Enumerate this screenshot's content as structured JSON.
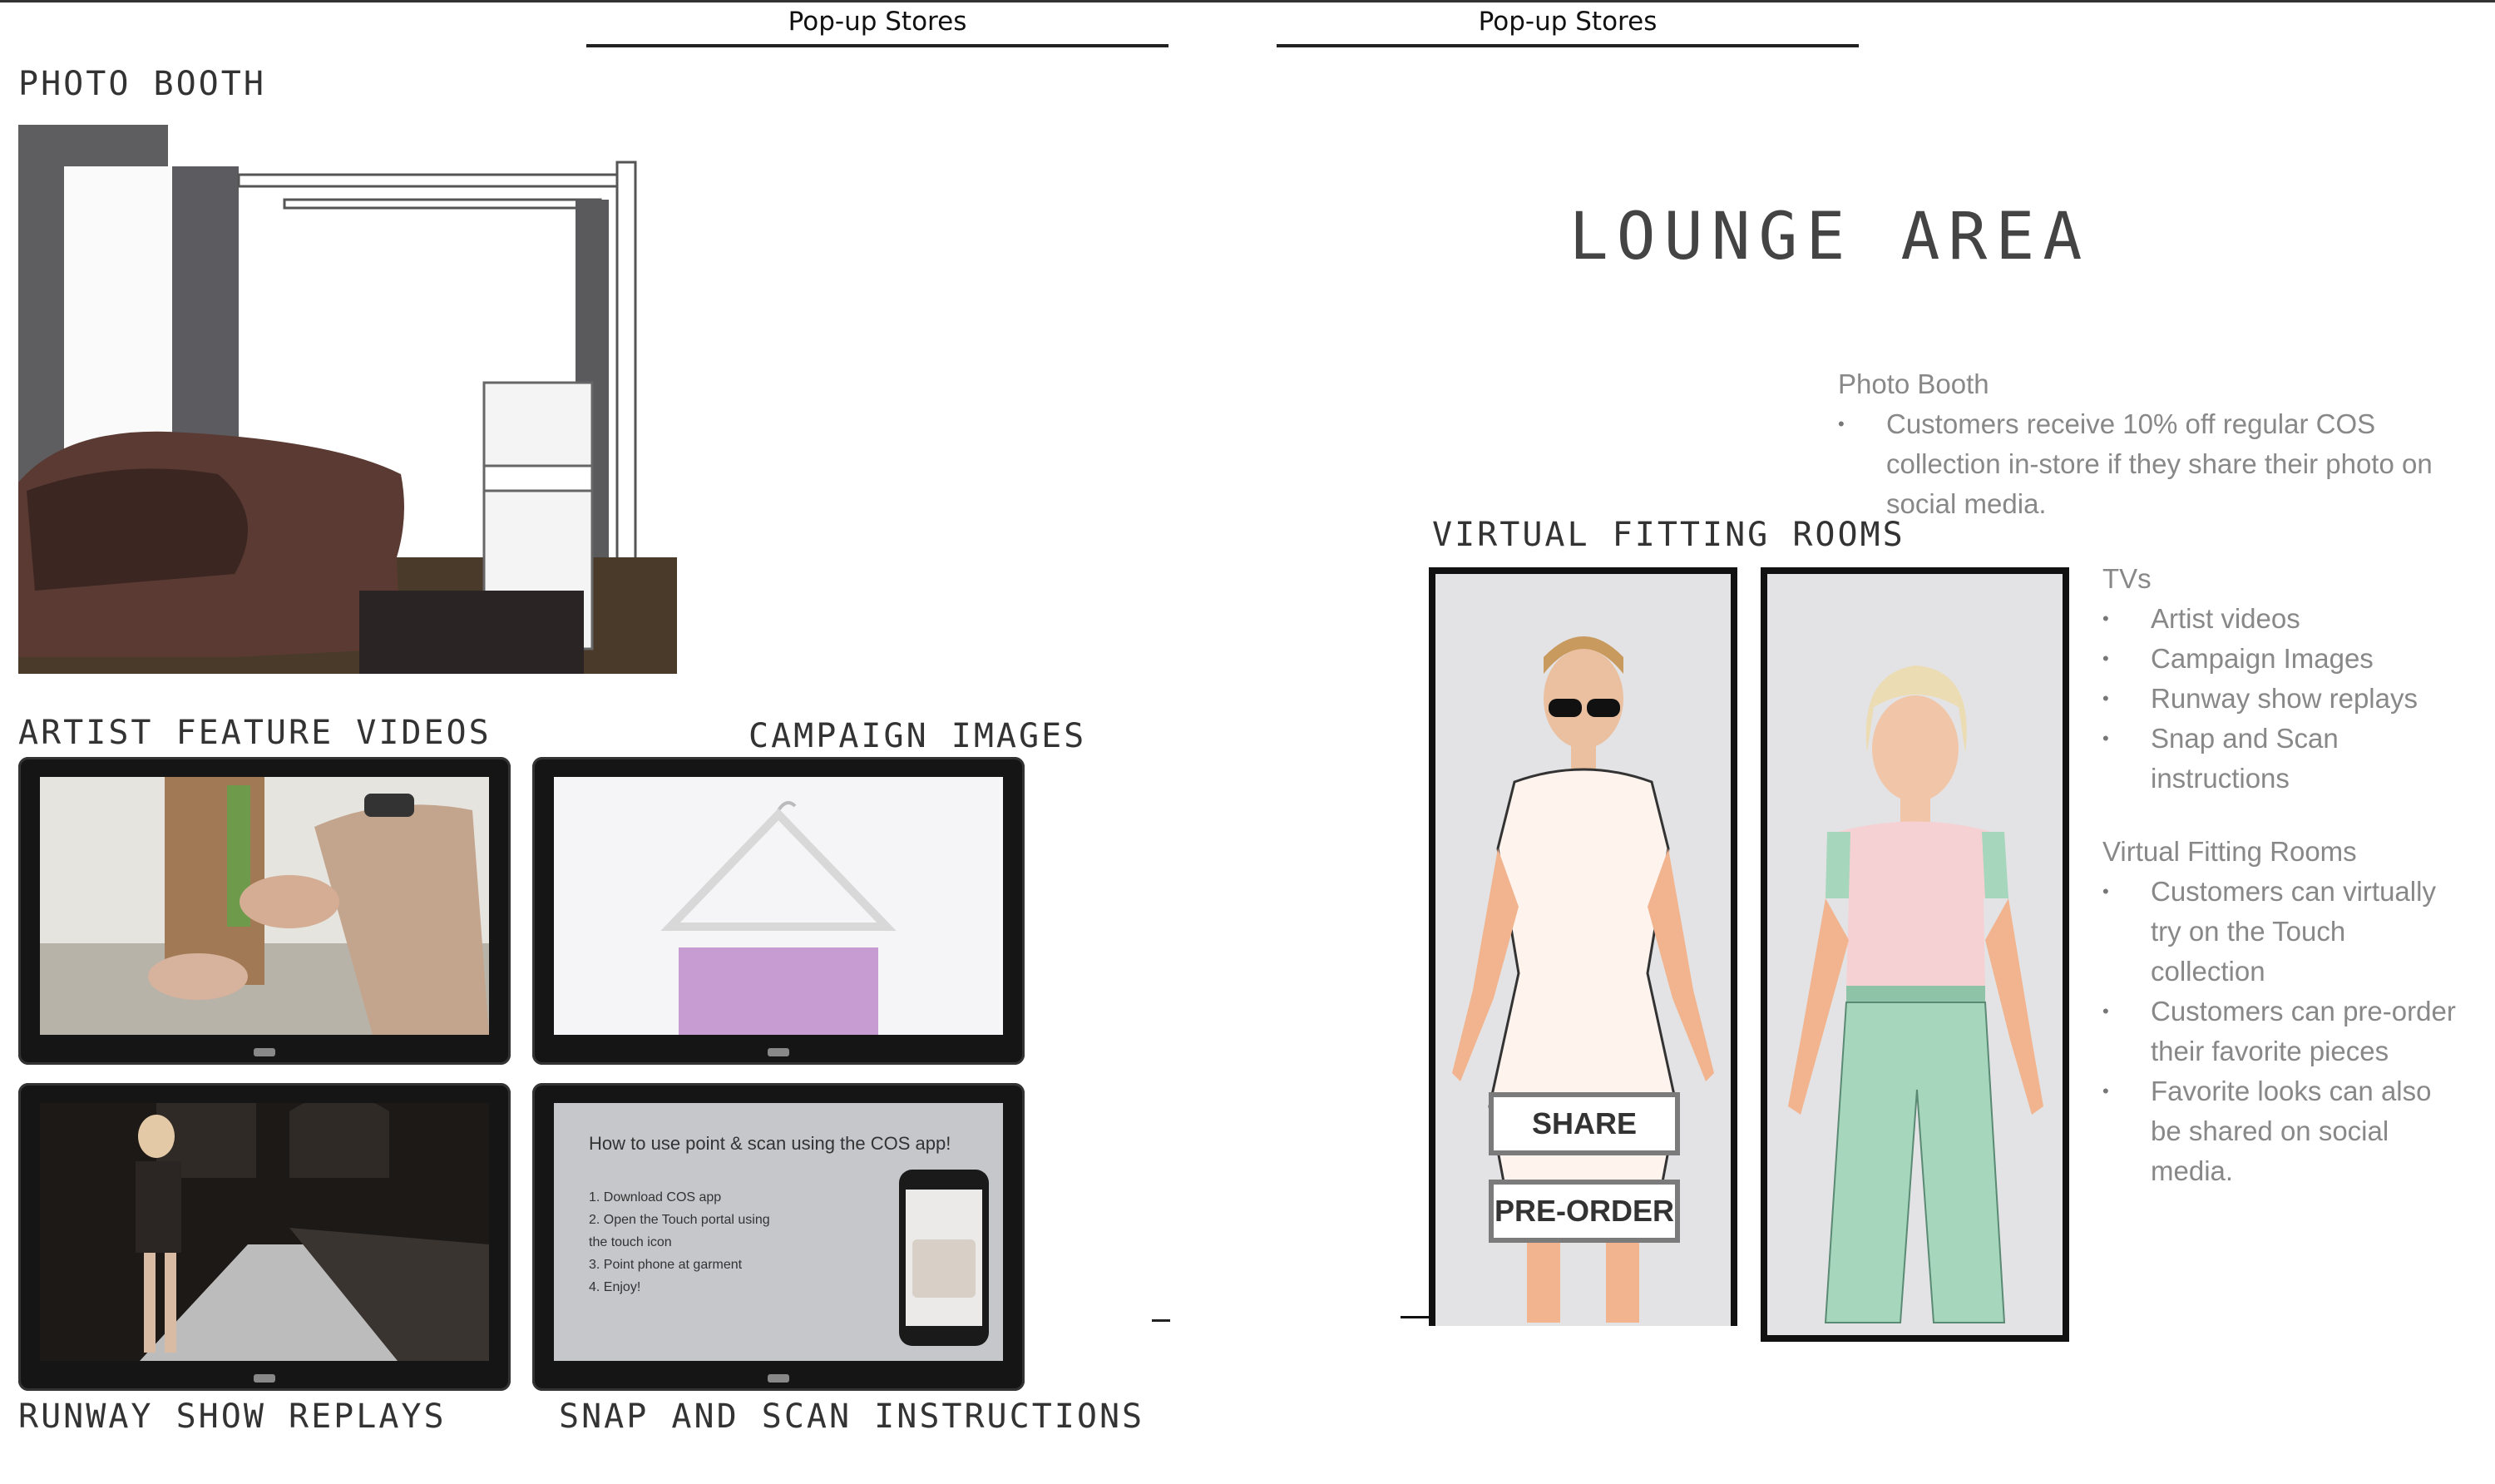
{
  "pages": {
    "left_tab": "Pop-up Stores",
    "right_tab": "Pop-up Stores"
  },
  "left": {
    "photo_booth_caption": "PHOTO BOOTH",
    "tv_captions": {
      "artist": "ARTIST FEATURE VIDEOS",
      "campaign": "CAMPAIGN IMAGES",
      "runway": "RUNWAY SHOW REPLAYS",
      "snap": "SNAP AND SCAN INSTRUCTIONS"
    },
    "snap_screen": {
      "title": "How to use point & scan using the COS app!",
      "steps": [
        "1. Download COS app",
        "2. Open the Touch portal using",
        "the touch icon",
        "3. Point phone at garment",
        "4. Enjoy!"
      ]
    }
  },
  "right": {
    "title": "LOUNGE AREA",
    "virtual_caption": "VIRTUAL FITTING ROOMS",
    "buttons": {
      "share": "SHARE",
      "preorder": "PRE-ORDER"
    },
    "photo_booth": {
      "heading": "Photo Booth",
      "bullets": [
        "Customers receive 10% off regular COS collection in-store if they share their photo on social media."
      ]
    },
    "tvs": {
      "heading": "TVs",
      "bullets": [
        "Artist videos",
        "Campaign Images",
        "Runway show replays",
        "Snap and Scan instructions"
      ]
    },
    "virtual_fitting": {
      "heading": "Virtual Fitting Rooms",
      "bullets": [
        "Customers can virtually try on the Touch collection",
        "Customers can pre-order their favorite pieces",
        "Favorite looks can also be shared on social media."
      ]
    }
  },
  "colors": {
    "ink": "#222222",
    "muted": "#888888",
    "booth_wall": "#5f5f62",
    "skirt": "#c79cd2",
    "pants": "#a6d6bb",
    "top_pink": "#f6d1d3"
  }
}
